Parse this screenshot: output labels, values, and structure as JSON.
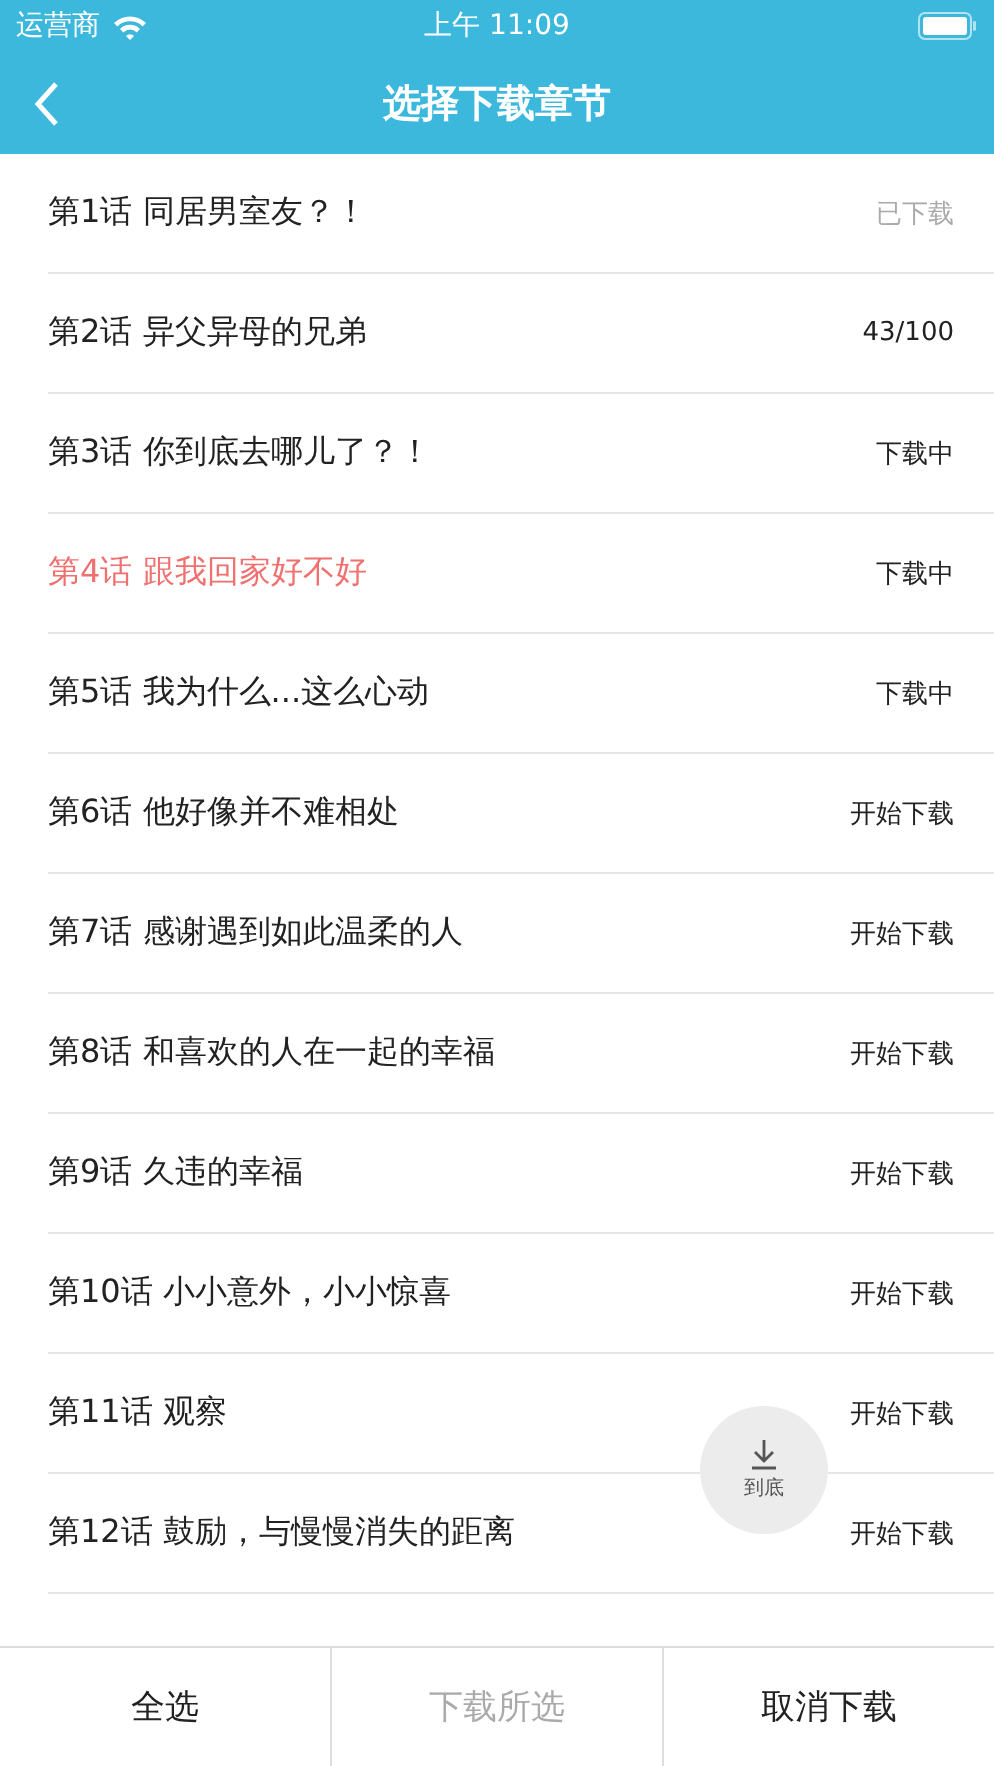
{
  "status_bar": {
    "carrier": "运营商",
    "time": "上午 11:09"
  },
  "nav": {
    "title": "选择下载章节"
  },
  "chapters": [
    {
      "title": "第1话 同居男室友？！",
      "status": "已下载",
      "downloaded": true,
      "selected": false
    },
    {
      "title": "第2话 异父异母的兄弟",
      "status": "43/100",
      "downloaded": false,
      "selected": false
    },
    {
      "title": "第3话 你到底去哪儿了？！",
      "status": "下载中",
      "downloaded": false,
      "selected": false
    },
    {
      "title": "第4话 跟我回家好不好",
      "status": "下载中",
      "downloaded": false,
      "selected": true
    },
    {
      "title": "第5话 我为什么...这么心动",
      "status": "下载中",
      "downloaded": false,
      "selected": false
    },
    {
      "title": "第6话 他好像并不难相处",
      "status": "开始下载",
      "downloaded": false,
      "selected": false
    },
    {
      "title": "第7话 感谢遇到如此温柔的人",
      "status": "开始下载",
      "downloaded": false,
      "selected": false
    },
    {
      "title": "第8话 和喜欢的人在一起的幸福",
      "status": "开始下载",
      "downloaded": false,
      "selected": false
    },
    {
      "title": "第9话 久违的幸福",
      "status": "开始下载",
      "downloaded": false,
      "selected": false
    },
    {
      "title": "第10话 小小意外，小小惊喜",
      "status": "开始下载",
      "downloaded": false,
      "selected": false
    },
    {
      "title": "第11话 观察",
      "status": "开始下载",
      "downloaded": false,
      "selected": false
    },
    {
      "title": "第12话 鼓励，与慢慢消失的距离",
      "status": "开始下载",
      "downloaded": false,
      "selected": false
    }
  ],
  "scroll_bottom_button": {
    "label": "到底"
  },
  "toolbar": [
    {
      "label": "全选",
      "disabled": false
    },
    {
      "label": "下载所选",
      "disabled": true
    },
    {
      "label": "取消下载",
      "disabled": false
    }
  ]
}
